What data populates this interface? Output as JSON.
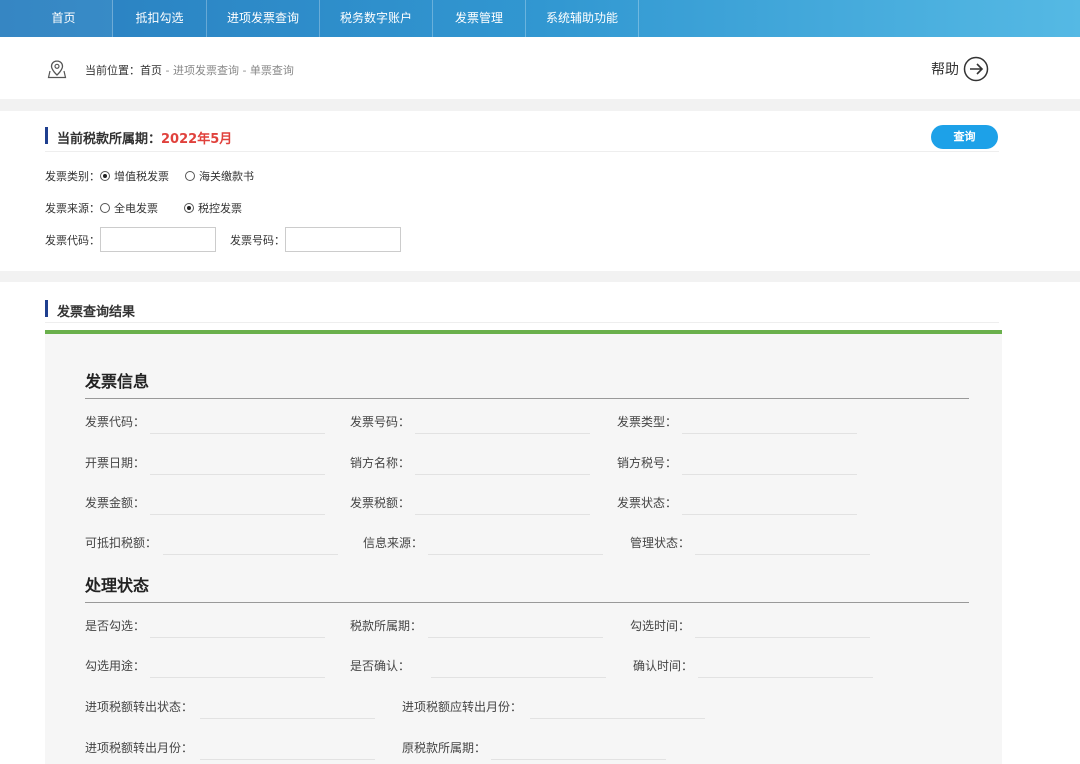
{
  "nav": {
    "items": [
      "首页",
      "抵扣勾选",
      "进项发票查询",
      "税务数字账户",
      "发票管理",
      "系统辅助功能"
    ]
  },
  "breadcrumb": {
    "prefix": "当前位置：首页",
    "rest": " - 进项发票查询 - 单票查询"
  },
  "help_label": "帮助",
  "query": {
    "period_label": "当前税款所属期：",
    "period_value": "2022年5月",
    "query_button": "查询",
    "invoice_category_label": "发票类别：",
    "invoice_category_options": [
      {
        "label": "增值税发票",
        "checked": true
      },
      {
        "label": "海关缴款书",
        "checked": false
      }
    ],
    "invoice_source_label": "发票来源：",
    "invoice_source_options": [
      {
        "label": "全电发票",
        "checked": false
      },
      {
        "label": "税控发票",
        "checked": true
      }
    ],
    "invoice_code_label": "发票代码：",
    "invoice_code_value": "",
    "invoice_number_label": "发票号码：",
    "invoice_number_value": ""
  },
  "result": {
    "title": "发票查询结果",
    "invoice_info_title": "发票信息",
    "invoice_fields": [
      "发票代码：",
      "发票号码：",
      "发票类型：",
      "开票日期：",
      "销方名称：",
      "销方税号：",
      "发票金额：",
      "发票税额：",
      "发票状态：",
      "可抵扣税额：",
      "信息来源：",
      "管理状态："
    ],
    "status_title": "处理状态",
    "status_fields": [
      "是否勾选：",
      "税款所属期：",
      "勾选时间：",
      "勾选用途：",
      "是否确认：",
      "确认时间：",
      "进项税额转出状态：",
      "进项税额应转出月份：",
      "进项税额转出月份：",
      "原税款所属期："
    ]
  },
  "colors": {
    "nav_start": "#2a7fc0",
    "nav_end": "#55b9e4",
    "accent_blue": "#1da1e8",
    "title_bar": "#1f3f8f",
    "period_red": "#e0413c",
    "result_green": "#6ab04c"
  }
}
